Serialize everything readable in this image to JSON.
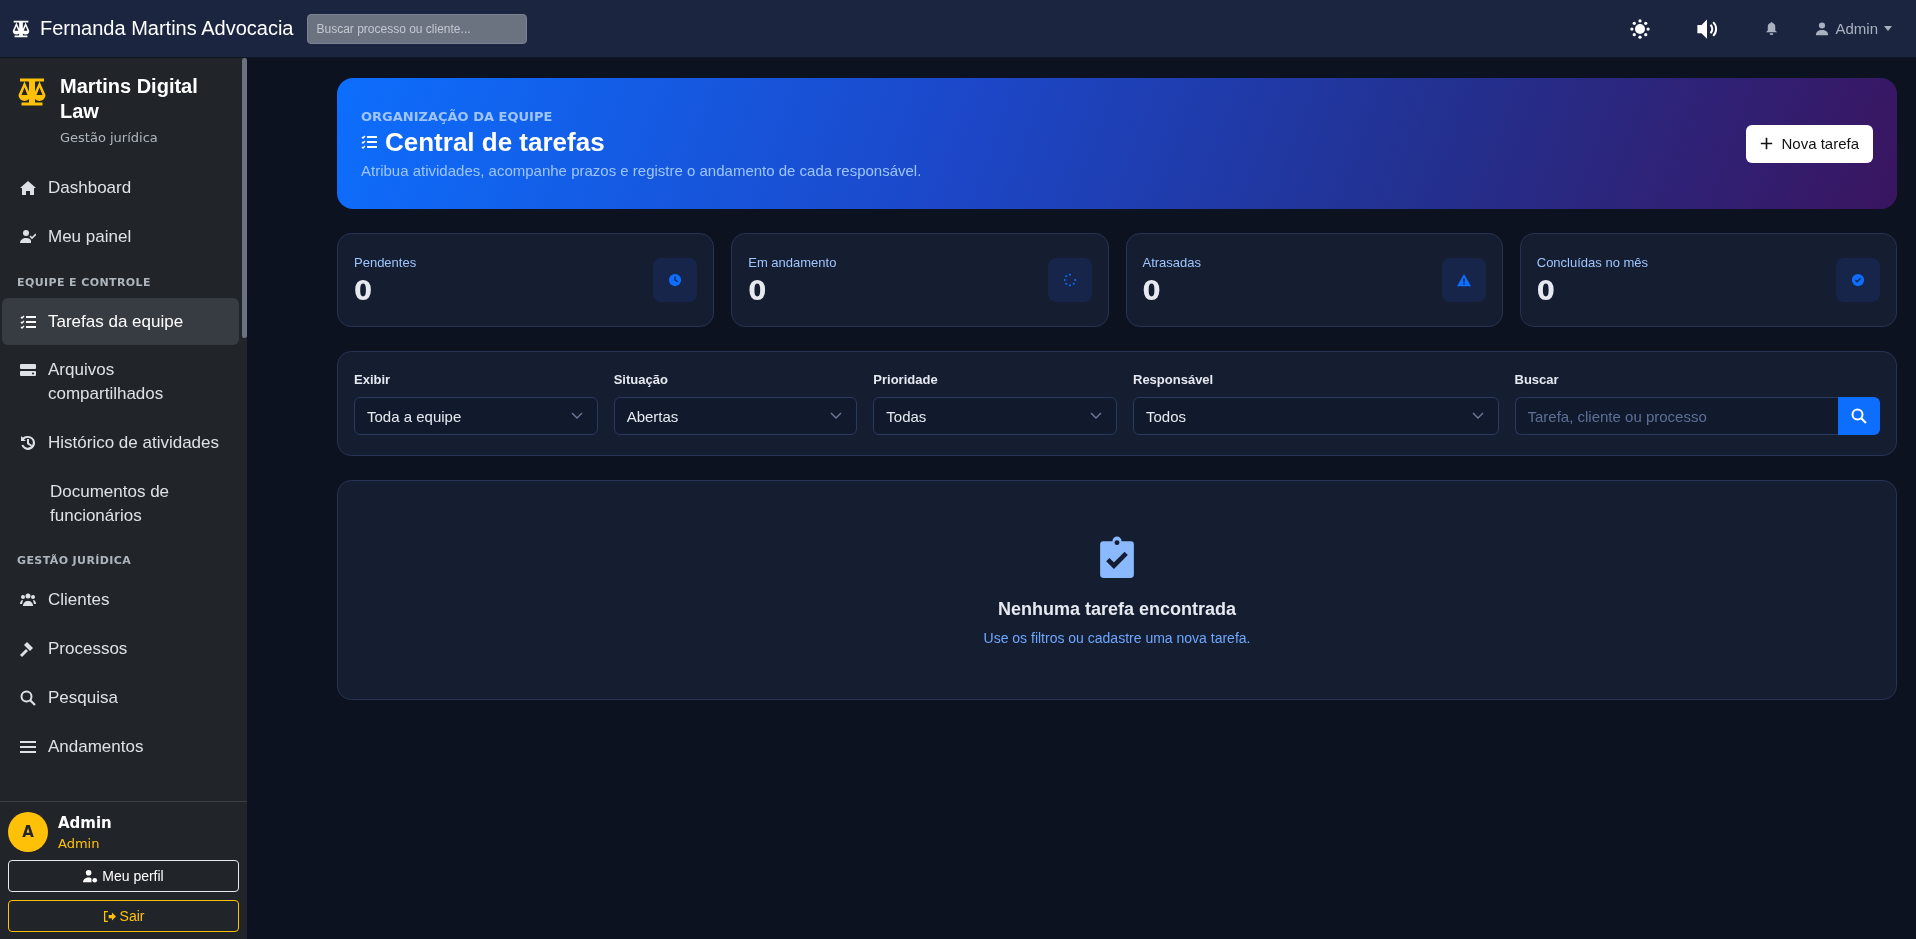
{
  "topbar": {
    "title": "Fernanda Martins Advocacia",
    "search": {
      "placeholder": "Buscar processo ou cliente..."
    },
    "user": "Admin"
  },
  "sidebar": {
    "brand": {
      "name": "Martins Digital Law",
      "subtitle": "Gestão jurídica"
    },
    "sections": [
      {
        "items": [
          {
            "label": "Dashboard",
            "selected": false
          },
          {
            "label": "Meu painel",
            "selected": false
          }
        ]
      },
      {
        "heading": "EQUIPE E CONTROLE",
        "items": [
          {
            "label": "Tarefas da equipe",
            "selected": true
          },
          {
            "label": "Arquivos compartilhados",
            "selected": false
          },
          {
            "label": "Histórico de atividades",
            "selected": false
          },
          {
            "label": "Documentos de funcionários",
            "selected": false
          }
        ]
      },
      {
        "heading": "GESTÃO JURÍDICA",
        "items": [
          {
            "label": "Clientes",
            "selected": false
          },
          {
            "label": "Processos",
            "selected": false
          },
          {
            "label": "Pesquisa",
            "selected": false
          },
          {
            "label": "Andamentos",
            "selected": false
          }
        ]
      }
    ],
    "user": {
      "avatar": "A",
      "name": "Admin",
      "role": "Admin",
      "buttons": [
        "Meu perfil",
        "Sair"
      ]
    }
  },
  "banner": {
    "eyebrow": "ORGANIZAÇÃO DA EQUIPE",
    "title": "Central de tarefas",
    "subtitle": "Atribua atividades, acompanhe prazos e registre o andamento de cada responsável.",
    "button": "Nova tarefa"
  },
  "stats": [
    {
      "label": "Pendentes",
      "value": "0"
    },
    {
      "label": "Em andamento",
      "value": "0"
    },
    {
      "label": "Atrasadas",
      "value": "0"
    },
    {
      "label": "Concluídas no mês",
      "value": "0"
    }
  ],
  "filters": [
    {
      "label": "Exibir",
      "value": "Toda a equipe"
    },
    {
      "label": "Situação",
      "value": "Abertas"
    },
    {
      "label": "Prioridade",
      "value": "Todas"
    },
    {
      "label": "Responsável",
      "value": "Todos"
    }
  ],
  "search": {
    "label": "Buscar",
    "placeholder": "Tarefa, cliente ou processo"
  },
  "empty": {
    "title": "Nenhuma tarefa encontrada",
    "message": "Use os filtros ou cadastre uma nova tarefa."
  }
}
